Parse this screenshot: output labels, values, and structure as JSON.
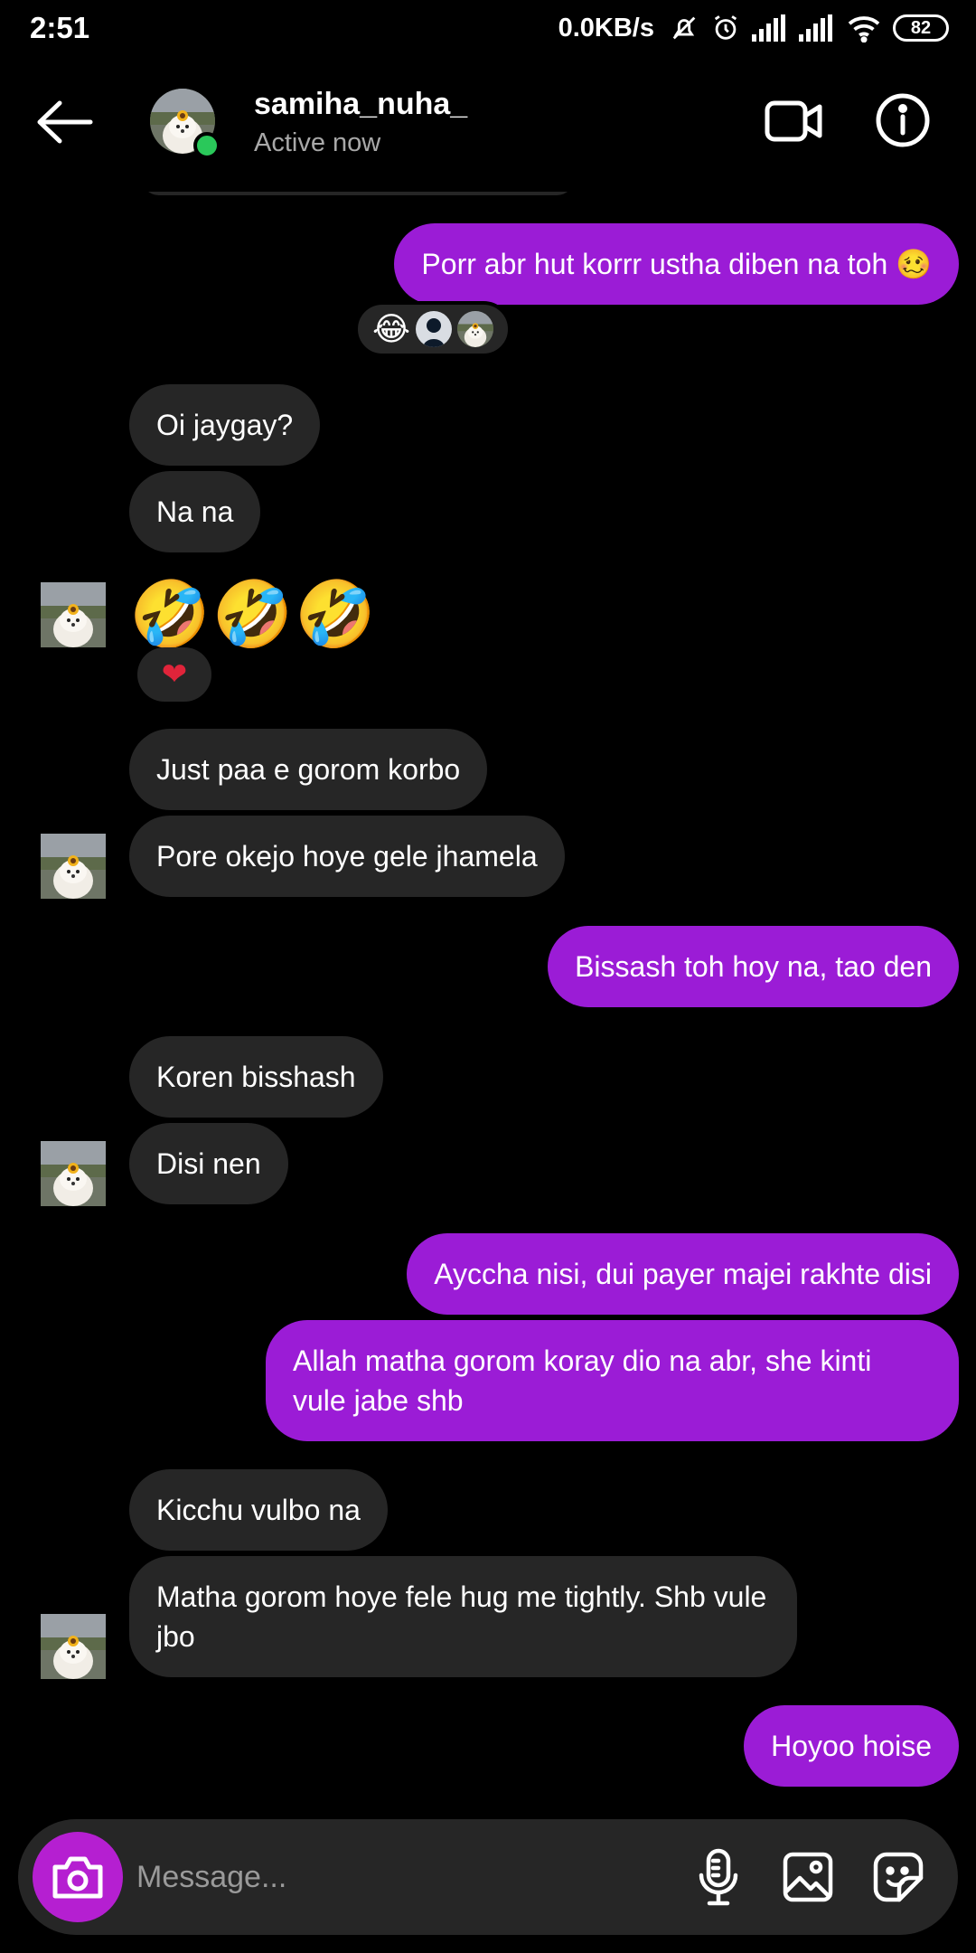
{
  "status_bar": {
    "time": "2:51",
    "speed": "0.0KB/s",
    "battery": "82"
  },
  "header": {
    "username": "samiha_nuha_",
    "status": "Active now"
  },
  "messages": [
    {
      "side": "out",
      "text": "Porr abr hut korrr ustha diben na toh 🥴"
    },
    {
      "side": "in",
      "text": "Oi jaygay?"
    },
    {
      "side": "in",
      "text": "Na na"
    },
    {
      "side": "in",
      "text": "🤣🤣🤣"
    },
    {
      "side": "in",
      "text": "Just paa e gorom korbo"
    },
    {
      "side": "in",
      "text": "Pore okejo hoye gele jhamela"
    },
    {
      "side": "out",
      "text": "Bissash toh hoy na, tao den"
    },
    {
      "side": "in",
      "text": "Koren bisshash"
    },
    {
      "side": "in",
      "text": "Disi nen"
    },
    {
      "side": "out",
      "text": "Ayccha nisi, dui payer majei rakhte disi"
    },
    {
      "side": "out",
      "text": "Allah matha gorom koray dio na abr, she kinti vule jabe shb"
    },
    {
      "side": "in",
      "text": "Kicchu vulbo na"
    },
    {
      "side": "in",
      "text": "Matha gorom hoye fele hug me tightly. Shb vule jbo"
    },
    {
      "side": "out",
      "text": "Hoyoo hoise"
    }
  ],
  "reactions": {
    "first": "😂",
    "heart": "❤"
  },
  "composer": {
    "placeholder": "Message..."
  },
  "colors": {
    "outgoing_bubble": "#9b1cd6",
    "incoming_bubble": "#262626",
    "online": "#2ac85a",
    "camera_button": "#b51fd1"
  }
}
